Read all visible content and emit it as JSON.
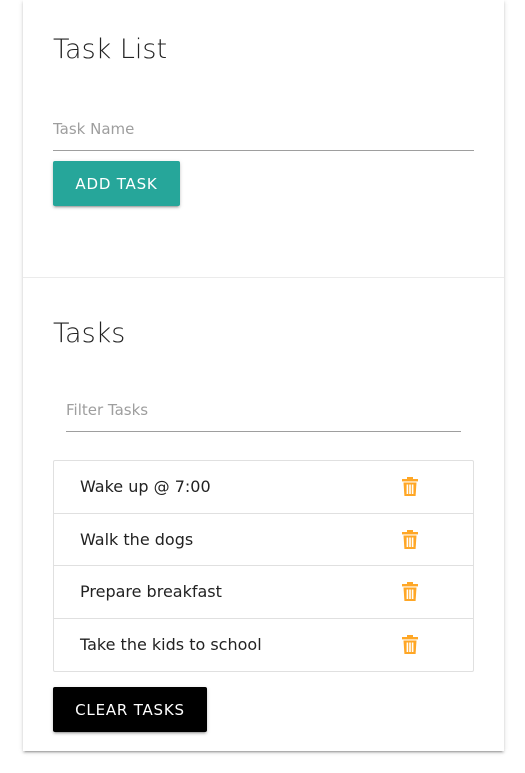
{
  "add_section": {
    "title": "Task List",
    "task_input_placeholder": "Task Name",
    "task_input_value": "",
    "add_button_label": "Add Task"
  },
  "tasks_section": {
    "title": "Tasks",
    "filter_placeholder": "Filter Tasks",
    "filter_value": "",
    "items": [
      {
        "label": "Wake up @ 7:00",
        "icon": "trash-icon"
      },
      {
        "label": "Walk the dogs",
        "icon": "trash-icon"
      },
      {
        "label": "Prepare breakfast",
        "icon": "trash-icon"
      },
      {
        "label": "Take the kids to school",
        "icon": "trash-icon"
      }
    ],
    "clear_button_label": "Clear Tasks"
  },
  "colors": {
    "add_button": "#26a69a",
    "clear_button": "#000000",
    "delete_icon": "#ffa726"
  }
}
